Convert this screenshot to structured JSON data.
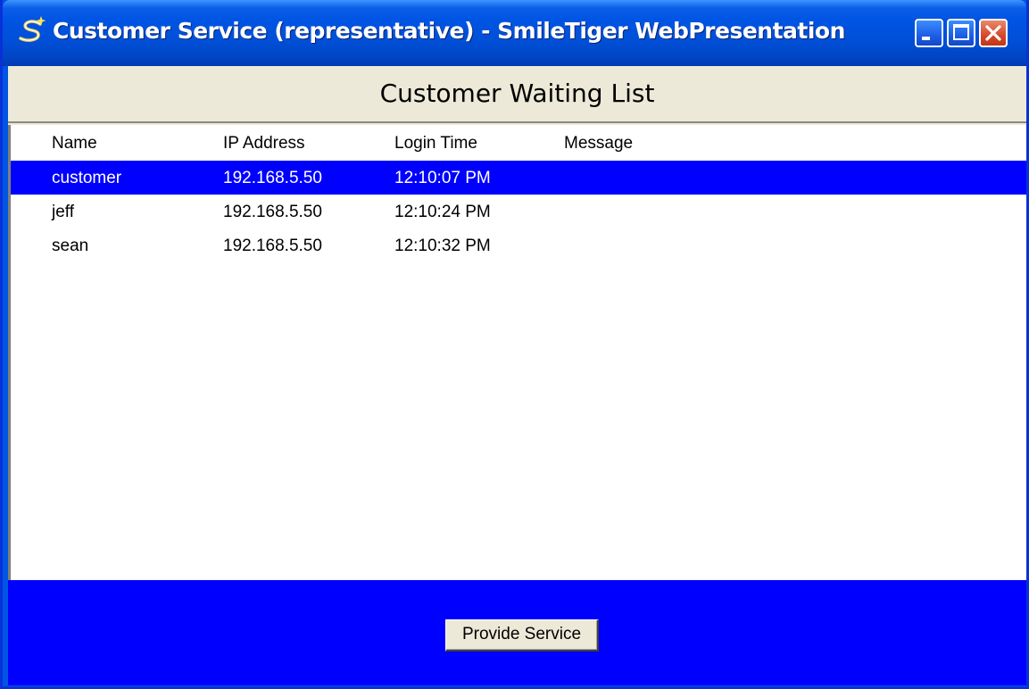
{
  "window": {
    "title": "Customer Service (representative) - SmileTiger WebPresentation",
    "icon": "smiletiger-icon",
    "controls": [
      "minimize-icon",
      "maximize-icon",
      "close-icon"
    ]
  },
  "heading": "Customer Waiting List",
  "list": {
    "columns": [
      "Name",
      "IP Address",
      "Login Time",
      "Message"
    ],
    "rows": [
      {
        "name": "customer",
        "ip": "192.168.5.50",
        "login_time": "12:10:07 PM",
        "message": "",
        "selected": true
      },
      {
        "name": "jeff",
        "ip": "192.168.5.50",
        "login_time": "12:10:24 PM",
        "message": "",
        "selected": false
      },
      {
        "name": "sean",
        "ip": "192.168.5.50",
        "login_time": "12:10:32 PM",
        "message": "",
        "selected": false
      }
    ]
  },
  "actions": {
    "provide_service_label": "Provide Service"
  },
  "colors": {
    "titlebar": "#0054e3",
    "selection": "#0000ff",
    "bottom_panel": "#0000ff",
    "client_bg": "#ece9d8"
  }
}
